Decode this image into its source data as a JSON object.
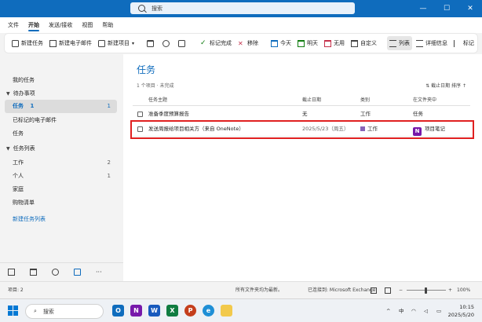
{
  "titlebar": {
    "search_placeholder": "搜索",
    "controls": [
      "—",
      "☐",
      "✕"
    ]
  },
  "menubar": {
    "items": [
      "文件",
      "开始",
      "发送/接收",
      "视图",
      "帮助"
    ],
    "active": "开始"
  },
  "ribbon": {
    "new_task": "新建任务",
    "new_email": "新建电子邮件",
    "new_item": "新建项目",
    "mark_complete": "标记完成",
    "remove": "移除",
    "today": "今天",
    "tomorrow": "明天",
    "no_date": "无用",
    "custom": "自定义",
    "list": "列表",
    "details": "详细信息",
    "flag": "标记",
    "more": "···"
  },
  "sidebar": {
    "my_tasks": "我的任务",
    "todo_group": "待办事项",
    "tasks_active": {
      "label": "任务",
      "count": "1"
    },
    "flagged_email": "已标记的电子邮件",
    "tasks": "任务",
    "task_lists_group": "任务列表",
    "lists": [
      {
        "label": "工作",
        "count": "2"
      },
      {
        "label": "个人",
        "count": "1"
      },
      {
        "label": "家庭",
        "count": ""
      },
      {
        "label": "购物清单",
        "count": ""
      }
    ],
    "new_list": "新建任务列表"
  },
  "main": {
    "title": "任务",
    "subtitle": "1 个项目 · 未完成",
    "sort_label": "截止日期 排序",
    "columns": [
      "任务主题",
      "截止日期",
      "类别",
      "在文件夹中"
    ],
    "rows": [
      {
        "subject": "准备季度预算报告",
        "due": "无",
        "category": "工作",
        "folder": "任务"
      },
      {
        "subject": "发送周报给项目相关方（来自 OneNote）",
        "due": "2025/5/23（周五）",
        "category": "工作",
        "folder": "项目笔记"
      }
    ]
  },
  "statusbar": {
    "items": "项目: 2",
    "folders_updated": "所有文件夹均为最新。",
    "connected": "已连接到: Microsoft Exchange",
    "zoom": "100%"
  },
  "taskbar": {
    "search": "搜索",
    "ime": "中",
    "time": "10:15",
    "date": "2025/5/20"
  },
  "colors": {
    "accent": "#0f6cbd",
    "highlight_border": "#e02020",
    "category_work": "#8764b8",
    "onenote": "#7719aa"
  }
}
